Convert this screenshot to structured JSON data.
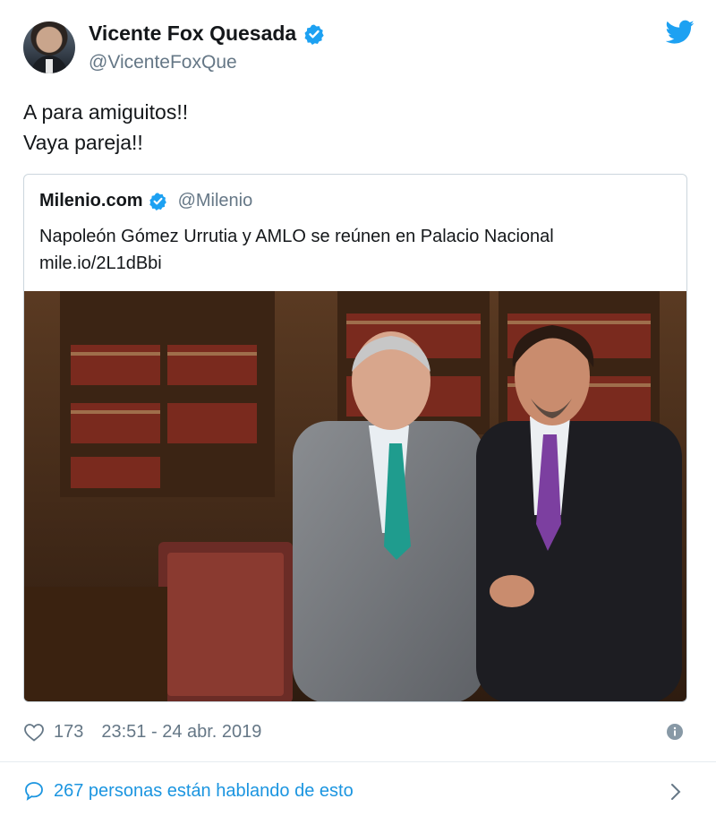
{
  "author": {
    "display_name": "Vicente Fox Quesada",
    "handle": "@VicenteFoxQue"
  },
  "tweet": {
    "line1": "A para amiguitos!!",
    "line2": "Vaya pareja!!"
  },
  "quoted": {
    "display_name": "Milenio.com",
    "handle": "@Milenio",
    "text": "Napoleón Gómez Urrutia y AMLO se reúnen en Palacio Nacional",
    "link": "mile.io/2L1dBbi"
  },
  "meta": {
    "likes": "173",
    "timestamp": "23:51 - 24 abr. 2019"
  },
  "footer": {
    "conversation": "267 personas están hablando de esto"
  },
  "colors": {
    "brand_blue": "#1da1f2",
    "link_blue": "#1b95e0",
    "secondary_text": "#657786",
    "border": "#ccd6dd"
  },
  "icons": {
    "verified": "verified-badge-icon",
    "twitter": "twitter-bird-icon",
    "like": "heart-icon",
    "info": "info-icon",
    "reply": "speech-bubble-icon",
    "chevron": "chevron-right-icon"
  }
}
